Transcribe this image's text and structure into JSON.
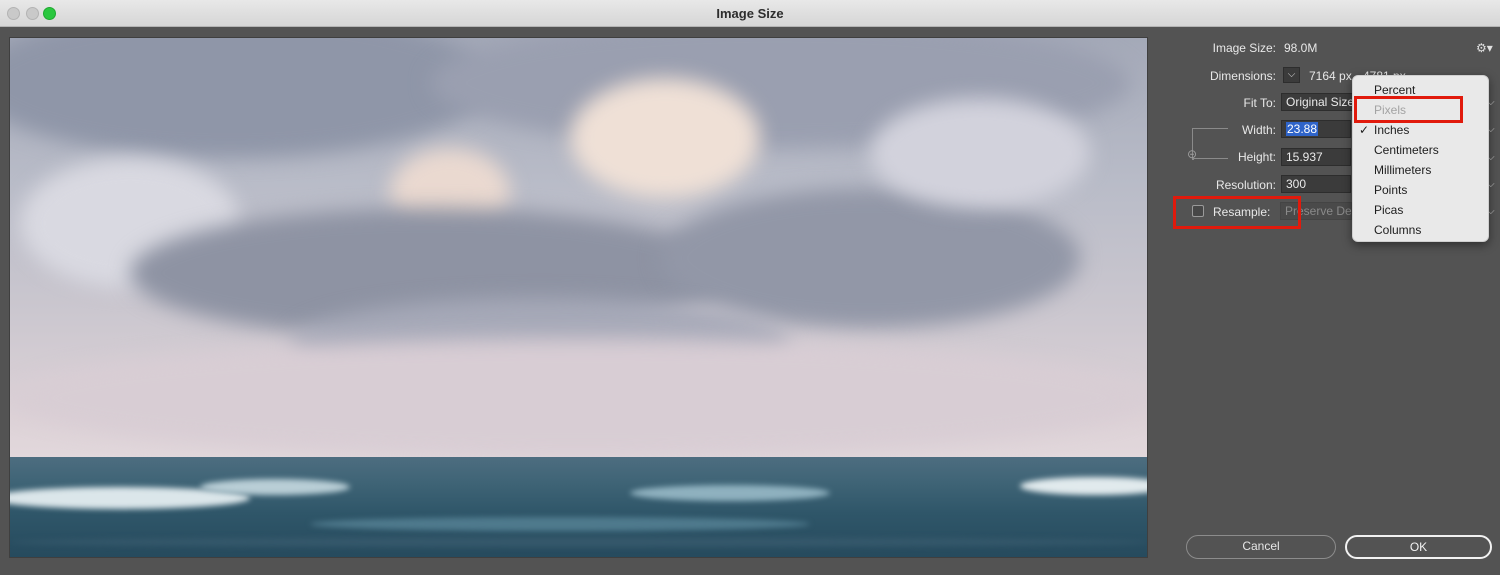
{
  "window": {
    "title": "Image Size"
  },
  "image_size": {
    "label": "Image Size:",
    "value": "98.0M"
  },
  "dimensions": {
    "label": "Dimensions:",
    "width_value": "7164 px",
    "height_value": "4781 px"
  },
  "fit_to": {
    "label": "Fit To:",
    "value": "Original Size"
  },
  "width": {
    "label": "Width:",
    "value": "23.88"
  },
  "height": {
    "label": "Height:",
    "value": "15.937"
  },
  "resolution": {
    "label": "Resolution:",
    "value": "300"
  },
  "resample": {
    "label": "Resample:",
    "checked": false,
    "method_value": "Preserve Details"
  },
  "unit_menu": {
    "items": [
      {
        "label": "Percent",
        "checked": false,
        "disabled": false
      },
      {
        "label": "Pixels",
        "checked": false,
        "disabled": true
      },
      {
        "label": "Inches",
        "checked": true,
        "disabled": false
      },
      {
        "label": "Centimeters",
        "checked": false,
        "disabled": false
      },
      {
        "label": "Millimeters",
        "checked": false,
        "disabled": false
      },
      {
        "label": "Points",
        "checked": false,
        "disabled": false
      },
      {
        "label": "Picas",
        "checked": false,
        "disabled": false
      },
      {
        "label": "Columns",
        "checked": false,
        "disabled": false
      }
    ]
  },
  "buttons": {
    "cancel": "Cancel",
    "ok": "OK"
  },
  "icons": {
    "settings": "gear-icon",
    "link": "chain-link-icon",
    "check": "checkmark-icon"
  },
  "colors": {
    "highlight": "#e11a0c",
    "selection": "#2f64c9"
  }
}
